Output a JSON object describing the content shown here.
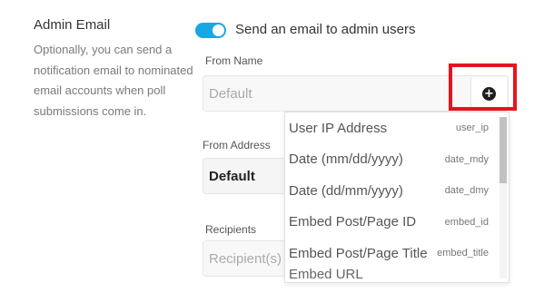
{
  "section": {
    "title": "Admin Email",
    "description": "Optionally, you can send a notification email to nominated email accounts when poll submissions come in."
  },
  "toggle": {
    "label": "Send an email to admin users",
    "checked": true,
    "color": "#17a8e3"
  },
  "from_name": {
    "label": "From Name",
    "placeholder": "Default",
    "insert_icon": "plus-circle-icon"
  },
  "from_address": {
    "label": "From Address",
    "value": "Default"
  },
  "recipients": {
    "label": "Recipients",
    "placeholder": "Recipient(s)"
  },
  "dropdown": {
    "items": [
      {
        "label": "User IP Address",
        "tag": "user_ip"
      },
      {
        "label": "Date (mm/dd/yyyy)",
        "tag": "date_mdy"
      },
      {
        "label": "Date (dd/mm/yyyy)",
        "tag": "date_dmy"
      },
      {
        "label": "Embed Post/Page ID",
        "tag": "embed_id"
      },
      {
        "label": "Embed Post/Page Title",
        "tag": "embed_title"
      }
    ],
    "partial_item": "Embed URL"
  },
  "highlight_color": "#e6141e"
}
